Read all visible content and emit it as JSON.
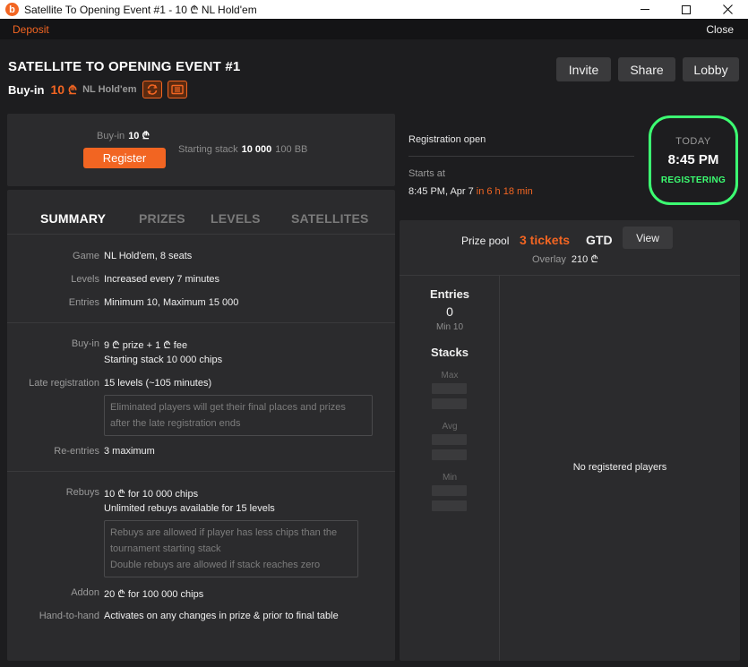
{
  "window": {
    "title": "Satellite To Opening Event #1 - 10 ₾ NL Hold'em",
    "logo_letter": "b",
    "controls": {
      "minimize": "—",
      "maximize": "☐",
      "close": "✕"
    }
  },
  "topbar": {
    "deposit_label": "Deposit",
    "close_label": "Close"
  },
  "header": {
    "title": "SATELLITE TO OPENING EVENT #1",
    "buyin_label": "Buy-in",
    "buyin_value": "10",
    "currency": "₾",
    "game": "NL Hold'em",
    "buttons": {
      "invite": "Invite",
      "share": "Share",
      "lobby": "Lobby"
    }
  },
  "registration": {
    "buyin_label": "Buy-in",
    "buyin_value": "10 ₾",
    "register_label": "Register",
    "stack_label": "Starting stack",
    "stack_value": "10 000",
    "stack_bb": "100 BB"
  },
  "status": {
    "reg_status": "Registration open",
    "starts_label": "Starts at",
    "starts_value": "8:45 PM, Apr 7",
    "countdown": "in 6 h 18 min",
    "clock_day": "TODAY",
    "clock_time": "8:45 PM",
    "clock_state": "REGISTERING",
    "accent_color": "#3cff72"
  },
  "tabs": {
    "summary": "SUMMARY",
    "prizes": "PRIZES",
    "levels": "LEVELS",
    "satellites": "SATELLITES"
  },
  "summary": {
    "game_label": "Game",
    "game_value": "NL Hold'em, 8 seats",
    "levels_label": "Levels",
    "levels_value": "Increased every 7 minutes",
    "entries_label": "Entries",
    "entries_value": "Minimum 10, Maximum 15 000",
    "buyin_label": "Buy-in",
    "buyin_value": "9 ₾ prize + 1 ₾ fee",
    "buyin_stack": "Starting stack 10 000 chips",
    "late_label": "Late registration",
    "late_value": "15 levels (~105 minutes)",
    "late_note_1": "Eliminated players will get their final places and prizes",
    "late_note_2": "after the late registration ends",
    "reentries_label": "Re-entries",
    "reentries_value": "3 maximum",
    "rebuys_label": "Rebuys",
    "rebuys_value": "10 ₾ for 10 000 chips",
    "rebuys_unlimited": "Unlimited rebuys available for 15 levels",
    "rebuy_note_1": "Rebuys are allowed if player has less chips than the",
    "rebuy_note_2": "tournament starting stack",
    "rebuy_note_3": "Double rebuys are allowed if stack reaches zero",
    "addon_label": "Addon",
    "addon_value": "20 ₾ for 100 000 chips",
    "h2h_label": "Hand-to-hand",
    "h2h_value": "Activates on any changes in prize & prior to final table"
  },
  "prize": {
    "label": "Prize pool",
    "value": "3 tickets",
    "gtd": "GTD",
    "view_label": "View",
    "overlay_label": "Overlay",
    "overlay_value": "210 ₾"
  },
  "stats": {
    "entries_title": "Entries",
    "entries_value": "0",
    "entries_min": "Min 10",
    "stacks_title": "Stacks",
    "max_label": "Max",
    "avg_label": "Avg",
    "min_label": "Min",
    "no_players": "No registered players"
  },
  "colors": {
    "accent": "#f26522",
    "background": "#1d1d1f",
    "panel": "#2b2b2d"
  }
}
